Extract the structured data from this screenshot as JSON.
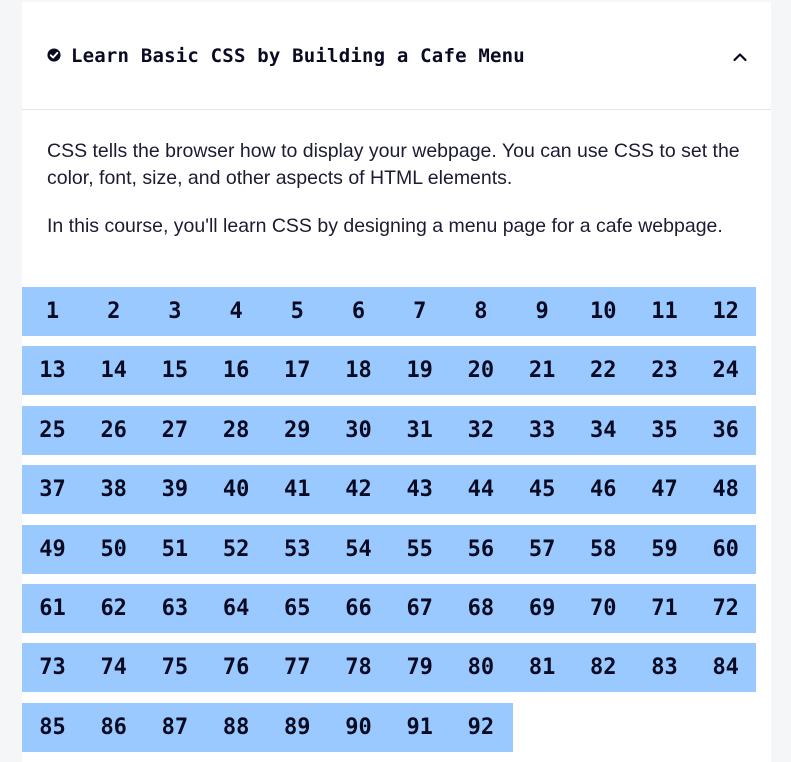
{
  "header": {
    "title": "Learn Basic CSS by Building a Cafe Menu",
    "status_icon": "check-circle-icon",
    "toggle_icon": "chevron-up-icon"
  },
  "description": [
    "CSS tells the browser how to display your webpage. You can use CSS to set the color, font, size, and other aspects of HTML elements.",
    "In this course, you'll learn CSS by designing a menu page for a cafe webpage."
  ],
  "colors": {
    "step_background": "#99c9ff",
    "text": "#0a0a23",
    "panel": "#ffffff",
    "page": "#f5f6f7"
  },
  "steps": [
    "1",
    "2",
    "3",
    "4",
    "5",
    "6",
    "7",
    "8",
    "9",
    "10",
    "11",
    "12",
    "13",
    "14",
    "15",
    "16",
    "17",
    "18",
    "19",
    "20",
    "21",
    "22",
    "23",
    "24",
    "25",
    "26",
    "27",
    "28",
    "29",
    "30",
    "31",
    "32",
    "33",
    "34",
    "35",
    "36",
    "37",
    "38",
    "39",
    "40",
    "41",
    "42",
    "43",
    "44",
    "45",
    "46",
    "47",
    "48",
    "49",
    "50",
    "51",
    "52",
    "53",
    "54",
    "55",
    "56",
    "57",
    "58",
    "59",
    "60",
    "61",
    "62",
    "63",
    "64",
    "65",
    "66",
    "67",
    "68",
    "69",
    "70",
    "71",
    "72",
    "73",
    "74",
    "75",
    "76",
    "77",
    "78",
    "79",
    "80",
    "81",
    "82",
    "83",
    "84",
    "85",
    "86",
    "87",
    "88",
    "89",
    "90",
    "91",
    "92"
  ]
}
